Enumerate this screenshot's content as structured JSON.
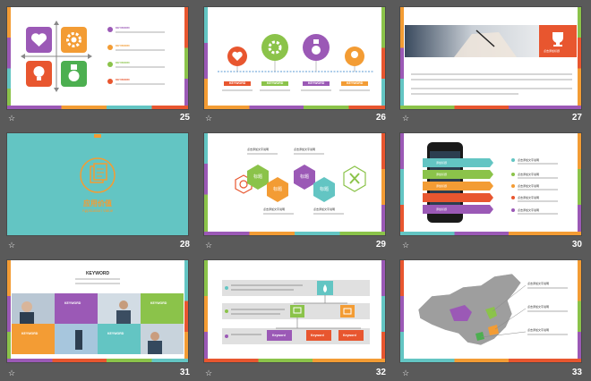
{
  "colors": {
    "purple": "#9b59b6",
    "orange": "#f39c34",
    "green": "#8bc34a",
    "red": "#e8562f",
    "teal": "#63c5c3",
    "gray_bg": "#5a5a5a"
  },
  "slides": [
    {
      "number": "25",
      "keywords": [
        "KEYWORD",
        "KEYWORD",
        "KEYWORD",
        "KEYWORD"
      ]
    },
    {
      "number": "26",
      "keywords": [
        "KEYWORD",
        "KEYWORD",
        "KEYWORD",
        "KEYWORD"
      ]
    },
    {
      "number": "27",
      "badge": "点击添加标题"
    },
    {
      "number": "28",
      "title_cn": "应用价值",
      "title_en": "Application Value"
    },
    {
      "number": "29",
      "labels": [
        "标题",
        "标题",
        "标题",
        "标题"
      ],
      "captions": [
        "点击添加文字说明",
        "点击添加文字说明",
        "点击添加文字说明",
        "点击添加文字说明"
      ]
    },
    {
      "number": "30",
      "phone_items": [
        "添加标题",
        "添加标题",
        "添加标题",
        "添加标题"
      ],
      "captions": [
        "点击添加文字说明",
        "点击添加文字说明",
        "点击添加文字说明",
        "点击添加文字说明",
        "点击添加文字说明"
      ]
    },
    {
      "number": "31",
      "heading": "KEYWORD",
      "keywords": [
        "KEYWORD",
        "KEYWORD",
        "KEYWORD",
        "KEYWORD"
      ]
    },
    {
      "number": "32",
      "keywords": [
        "Keyword",
        "Keyword",
        "Keyword"
      ]
    },
    {
      "number": "33",
      "captions": [
        "点击添加文字说明",
        "点击添加文字说明",
        "点击添加文字说明"
      ]
    }
  ]
}
